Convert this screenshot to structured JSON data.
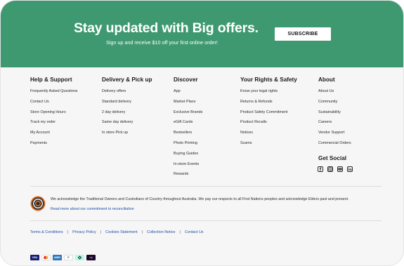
{
  "banner": {
    "title": "Stay updated with Big offers.",
    "subtitle": "Sign up and receive $10 off your first online order!",
    "subscribe_label": "SUBSCRIBE",
    "background": "#3f9970"
  },
  "columns": [
    {
      "title": "Help & Support",
      "links": [
        "Frequently Asked Questions",
        "Contact Us",
        "Store Opening Hours",
        "Track my order",
        "My Account",
        "Payments"
      ]
    },
    {
      "title": "Delivery & Pick up",
      "links": [
        "Delivery offers",
        "Standard delivery",
        "2 day delivery",
        "Same day delivery",
        "In store Pick up"
      ]
    },
    {
      "title": "Discover",
      "links": [
        "App",
        "Market Place",
        "Exclusive Brands",
        "eGift Cards",
        "Bestsellers",
        "Photo Printing",
        "Buying Guides",
        "In-store Events",
        "Rewards"
      ]
    },
    {
      "title": "Your Rights & Safety",
      "links": [
        "Know your legal rights",
        "Returns & Refunds",
        "Product Safety Commitment",
        "Product Recalls",
        "Notices",
        "Scams"
      ]
    },
    {
      "title": "About",
      "links": [
        "About Us",
        "Community",
        "Sustainability",
        "Careers",
        "Vendor Support",
        "Commercial Orders"
      ]
    }
  ],
  "social": {
    "title": "Get Social",
    "icons": [
      "facebook-icon",
      "instagram-icon",
      "youtube-icon",
      "linkedin-icon"
    ]
  },
  "acknowledgement": {
    "text": "We acknowledge the Traditional Owners and Custodians of Country throughout Australia. We pay our respects to all First Nations peoples and acknowledge Elders past and present.",
    "link": "Read more about our commitment to reconciliation"
  },
  "legal_links": [
    "Terms & Conditions",
    "Privacy Policy",
    "Cookies Statement",
    "Collection Notice",
    "Contact Us"
  ],
  "payment_methods": [
    {
      "icon": "visa-icon",
      "label": "VISA",
      "color": "#1a1f71"
    },
    {
      "icon": "mastercard-icon",
      "label": "",
      "color": "#ffffff"
    },
    {
      "icon": "amex-icon",
      "label": "AMEX",
      "color": "#2e77bc"
    },
    {
      "icon": "paypal-icon",
      "label": "P",
      "color": "#ffffff"
    },
    {
      "icon": "afterpay-icon",
      "label": "",
      "color": "#b2fce4"
    },
    {
      "icon": "zip-icon",
      "label": "zip",
      "color": "#1a0826"
    }
  ]
}
